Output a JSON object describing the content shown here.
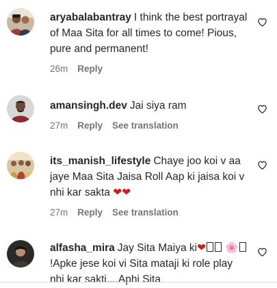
{
  "comments": [
    {
      "username": "aryabalabantray",
      "text": "I think the best portrayal of Maa Sita for all times to come! Pious, pure and permanent!",
      "time": "26m",
      "reply_label": "Reply",
      "translation_label": ""
    },
    {
      "username": "amansingh.dev",
      "text": "Jai siya ram",
      "time": "27m",
      "reply_label": "Reply",
      "translation_label": "See translation"
    },
    {
      "username": "its_manish_lifestyle",
      "text": "Chaye joo koi v aa jaye Maa Sita Jaisa Roll Aap ki jaisa koi v nhi kar sakta",
      "text_suffix": "❤❤",
      "time": "27m",
      "reply_label": "Reply",
      "translation_label": "See translation"
    },
    {
      "username": "alfasha_mira",
      "text_part1": "Jay Sita Maiya ki",
      "text_heart": "❤",
      "text_flower": "🌸",
      "text_part2": "!Apke jese koi vi Sita mataji ki role play nhi kar sakti....Aphi Sita",
      "time": "",
      "reply_label": "",
      "translation_label": ""
    }
  ],
  "icons": {
    "like": "heart-outline-icon"
  },
  "colors": {
    "text": "#262626",
    "meta": "#737373",
    "heart": "#d61a1a"
  }
}
